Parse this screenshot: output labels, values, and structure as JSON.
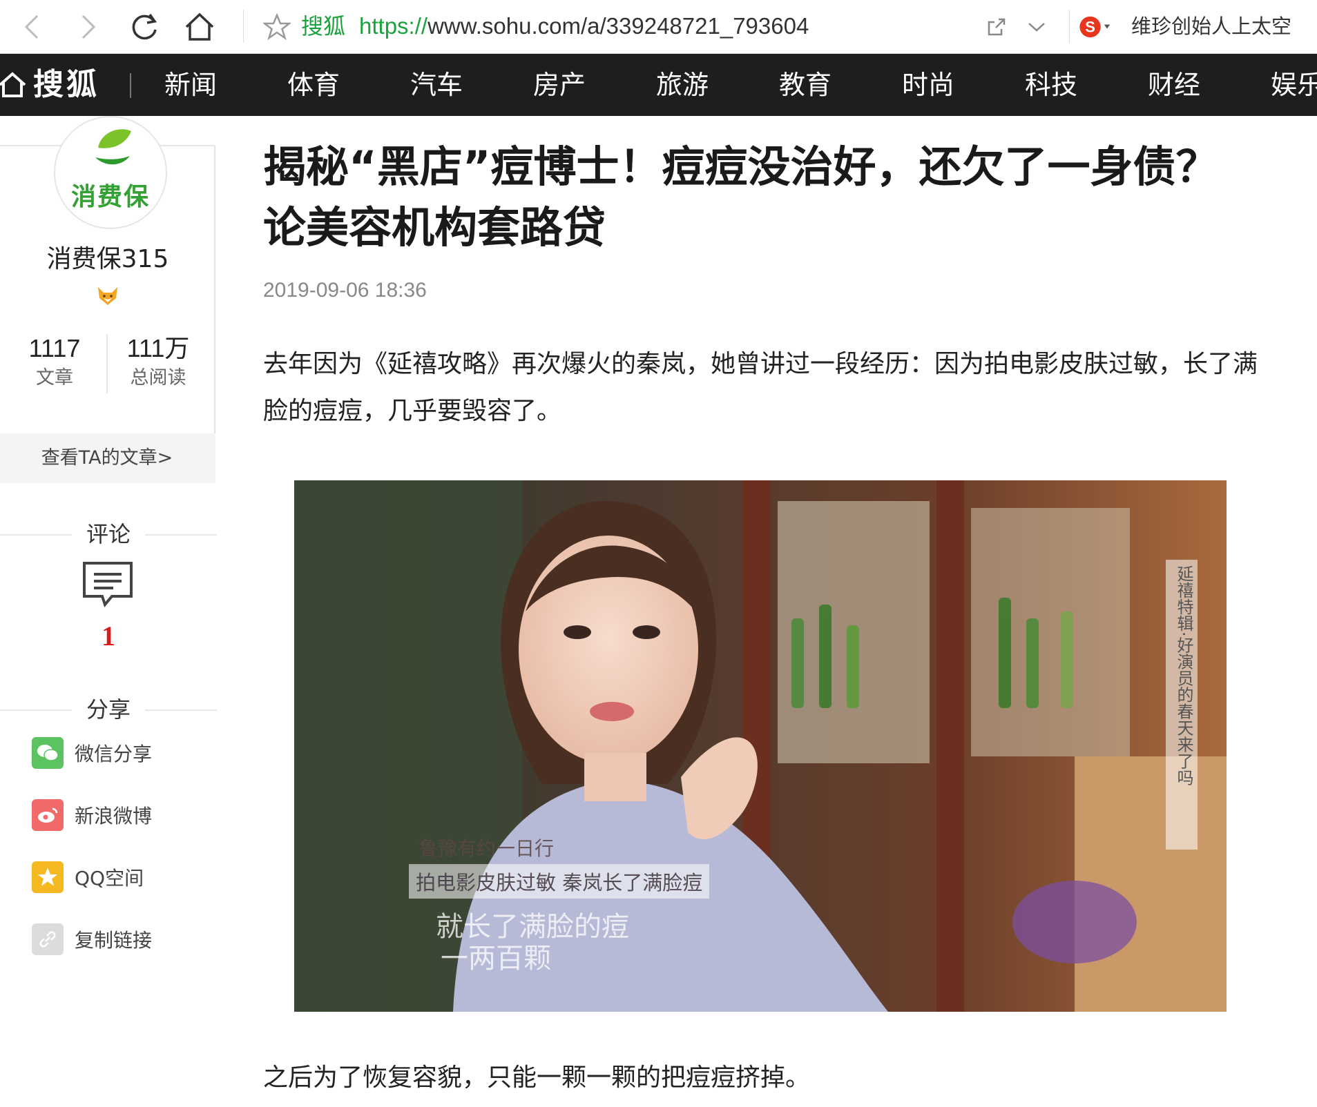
{
  "browser": {
    "site_name": "搜狐",
    "url_protocol": "https://",
    "url_rest": "www.sohu.com/a/339248721_793604",
    "search_hint": "维珍创始人上太空"
  },
  "site_nav": {
    "logo": "搜狐",
    "items": [
      "新闻",
      "体育",
      "汽车",
      "房产",
      "旅游",
      "教育",
      "时尚",
      "科技",
      "财经",
      "娱乐"
    ]
  },
  "author": {
    "avatar_text": "消费保",
    "name": "消费保315",
    "articles_count": "1117",
    "articles_label": "文章",
    "reads_count": "111万",
    "reads_label": "总阅读",
    "link": "查看TA的文章>"
  },
  "comments": {
    "heading": "评论",
    "count": "1"
  },
  "share": {
    "heading": "分享",
    "items": [
      "微信分享",
      "新浪微博",
      "QQ空间",
      "复制链接"
    ]
  },
  "article": {
    "title_line1": "揭秘“黑店”痘博士！痘痘没治好，还欠了一身债？",
    "title_line2": "论美容机构套路贷",
    "date": "2019-09-06 18:36",
    "para1_line1": "去年因为《延禧攻略》再次爆火的秦岚，她曾讲过一段经历：因为拍电影皮肤过敏，长了满",
    "para1_line2": "脸的痘痘，几乎要毁容了。",
    "para2": "之后为了恢复容貌，只能一颗一颗的把痘痘挤掉。",
    "image_captions": {
      "line1": "鲁豫有约一日行",
      "line2": "拍电影皮肤过敏 秦岚长了满脸痘",
      "line3": "就长了满脸的痘",
      "line4": "一两百颗",
      "vertical": "延禧特辑·好演员的春天来了吗"
    }
  }
}
